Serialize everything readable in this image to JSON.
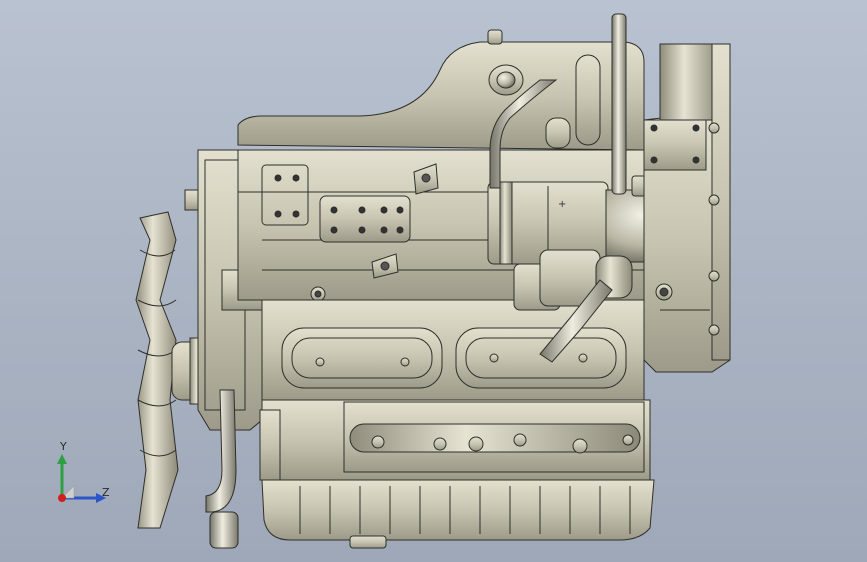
{
  "scene": {
    "background_top": "#b9c2d0",
    "background_bottom": "#9ea8b8",
    "part_color": "#c9c6b3",
    "part_shadow": "#6f6d61",
    "edge_color": "#2f2f2a"
  },
  "triad": {
    "y_label": "Y",
    "z_label": "Z",
    "y_color": "#2ea043",
    "z_color": "#2b55c9",
    "origin_color": "#d11f1f"
  }
}
